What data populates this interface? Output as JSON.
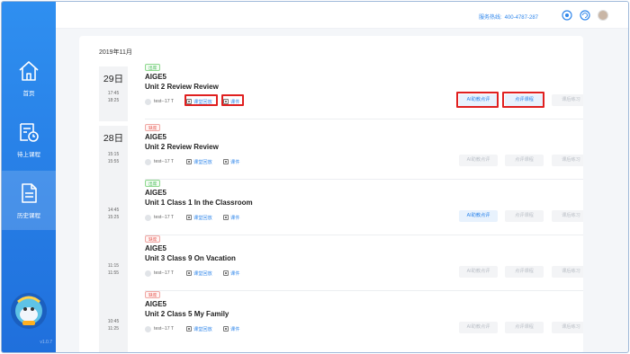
{
  "app": {
    "version": "v1.0.7"
  },
  "sidebar": {
    "items": [
      {
        "label": "首页",
        "icon": "home-icon",
        "active": false
      },
      {
        "label": "待上课程",
        "icon": "calendar-icon",
        "active": false
      },
      {
        "label": "历史课程",
        "icon": "document-icon",
        "active": true
      }
    ],
    "mascot": "mascot-avatar"
  },
  "topbar": {
    "hotline_label": "服务热线:",
    "hotline_number": "400-4787-287",
    "icons": [
      "settings-icon",
      "refresh-icon",
      "user-avatar"
    ]
  },
  "main": {
    "month": "2019年11月",
    "days": [
      {
        "day": "29日",
        "times": [
          "17:45",
          "18:25"
        ]
      },
      {
        "day": "28日",
        "times": [
          "15:15",
          "15:55",
          "14:45",
          "15:25",
          "11:15",
          "11:55",
          "10:45",
          "11:25"
        ]
      }
    ],
    "lesson_common": {
      "course": "AIGE5",
      "teacher": "test--17 T",
      "replay_label": "课堂回放",
      "courseware_label": "课件",
      "btn_ai": "AI助教点评",
      "btn_review": "点评课程",
      "btn_practice": "课后练习"
    },
    "lessons": [
      {
        "status": "出席",
        "status_color": "green",
        "title": "Unit 2 Review Review",
        "ai_enabled": true,
        "review_enabled": true,
        "practice_enabled": false,
        "highlighted": true
      },
      {
        "status": "缺席",
        "status_color": "red",
        "title": "Unit 2 Review Review",
        "ai_enabled": false,
        "review_enabled": false,
        "practice_enabled": false,
        "highlighted": false
      },
      {
        "status": "出席",
        "status_color": "green",
        "title": "Unit 1 Class 1 In the Classroom",
        "ai_enabled": true,
        "review_enabled": false,
        "practice_enabled": false,
        "highlighted": false
      },
      {
        "status": "缺席",
        "status_color": "red",
        "title": "Unit 3 Class 9 On Vacation",
        "ai_enabled": false,
        "review_enabled": false,
        "practice_enabled": false,
        "highlighted": false
      },
      {
        "status": "缺席",
        "status_color": "red",
        "title": "Unit 2 Class 5 My Family",
        "ai_enabled": false,
        "review_enabled": false,
        "practice_enabled": false,
        "highlighted": false
      }
    ]
  },
  "colors": {
    "sidebar_top": "#2f8ff0",
    "sidebar_bottom": "#1f6fdc",
    "accent": "#2f86eb",
    "highlight_box": "#e02020",
    "badge_green": "#3fb950",
    "badge_red": "#e5534b"
  }
}
